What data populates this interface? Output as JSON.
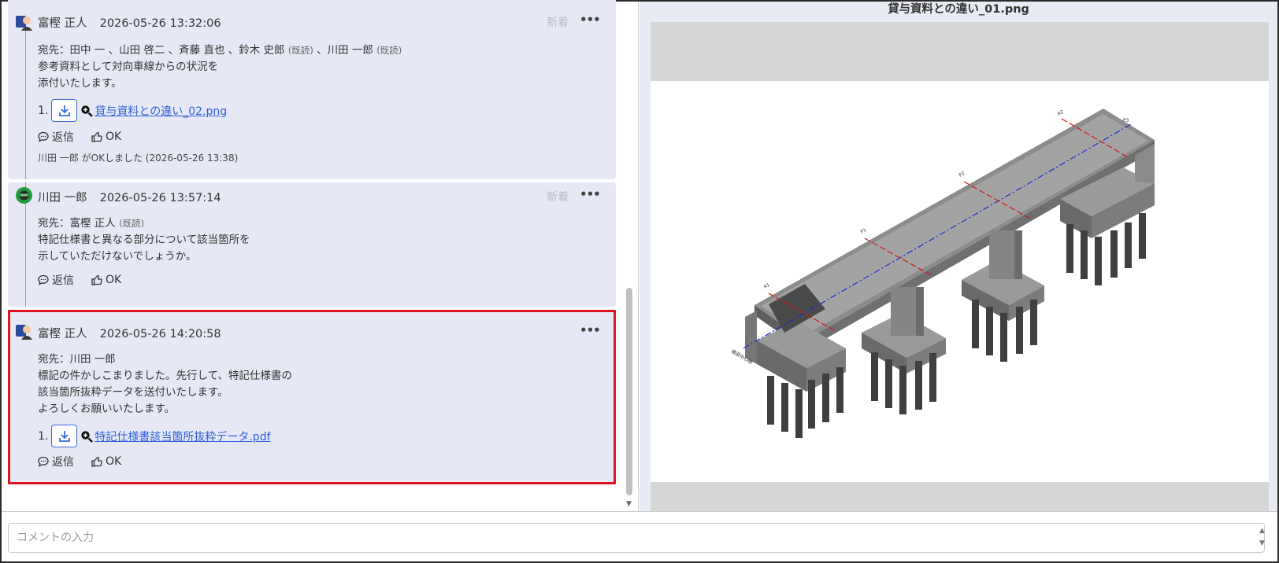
{
  "messages": [
    {
      "sender": "富樫 正人",
      "timestamp": "2026-05-26 13:32:06",
      "new_label": "新着",
      "recipients_prefix": "宛先：",
      "recipients_text": "田中 一 、山田 啓二 、斉藤 直也 、鈴木 史郎",
      "read_mark_1": "(既読)",
      "recipients_sep": " 、川田 一郎 ",
      "read_mark_2": "(既読)",
      "body_lines": [
        "参考資料として対向車線からの状況を",
        "添付いたします。"
      ],
      "attachment_index": "1.",
      "attachment_name": "貸与資料との違い_02.png",
      "reply_label": "返信",
      "ok_label": "OK",
      "ok_note": "川田 一郎 がOKしました (2026-05-26 13:38)"
    },
    {
      "sender": "川田 一郎",
      "timestamp": "2026-05-26 13:57:14",
      "new_label": "新着",
      "recipients_prefix": "宛先：",
      "recipients_text": "富樫 正人 ",
      "read_mark_1": "(既読)",
      "body_lines": [
        "特記仕様書と異なる部分について該当箇所を",
        "示していただけないでしょうか。"
      ],
      "reply_label": "返信",
      "ok_label": "OK"
    },
    {
      "sender": "富樫 正人",
      "timestamp": "2026-05-26 14:20:58",
      "recipients_prefix": "宛先：",
      "recipients_text": "川田 一郎",
      "body_lines": [
        "標記の件かしこまりました。先行して、特記仕様書の",
        "該当箇所抜粋データを送付いたします。",
        "よろしくお願いいたします。"
      ],
      "attachment_index": "1.",
      "attachment_name": "特記仕様書該当箇所抜粋データ.pdf",
      "reply_label": "返信",
      "ok_label": "OK"
    }
  ],
  "viewer": {
    "title": "貸与資料との違い_01.png",
    "image_labels": [
      "橋梁中心線",
      "P1",
      "P2",
      "P3",
      "A1",
      "A2"
    ]
  },
  "comment": {
    "placeholder": "コメントの入力"
  },
  "colors": {
    "card_bg": "#e6e9f5",
    "highlight_border": "#e0141e",
    "link": "#2e5fd8",
    "centerline": "#1a2bd1",
    "pier_line": "#d01818"
  }
}
